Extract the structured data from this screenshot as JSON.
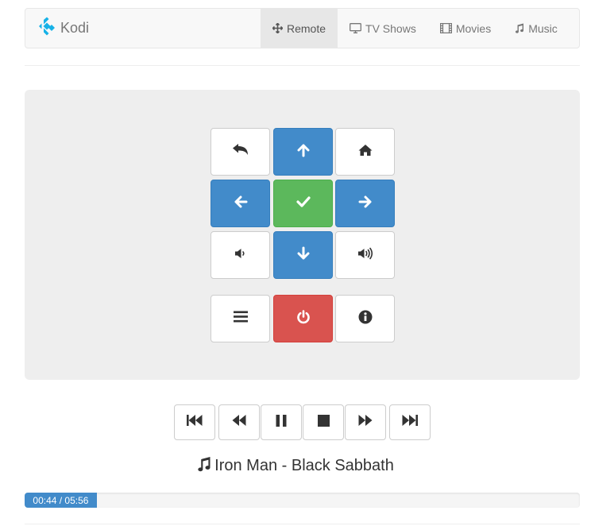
{
  "brand": {
    "name": "Kodi"
  },
  "nav": [
    {
      "label": "Remote",
      "icon": "move-icon",
      "active": true
    },
    {
      "label": "TV Shows",
      "icon": "tv-icon",
      "active": false
    },
    {
      "label": "Movies",
      "icon": "film-icon",
      "active": false
    },
    {
      "label": "Music",
      "icon": "music-note-icon",
      "active": false
    }
  ],
  "remote": {
    "buttons": [
      {
        "name": "back",
        "icon": "back-arrow-icon",
        "style": "default"
      },
      {
        "name": "up",
        "icon": "arrow-up-icon",
        "style": "primary"
      },
      {
        "name": "home",
        "icon": "home-icon",
        "style": "default"
      },
      {
        "name": "left",
        "icon": "arrow-left-icon",
        "style": "primary"
      },
      {
        "name": "select",
        "icon": "check-icon",
        "style": "success"
      },
      {
        "name": "right",
        "icon": "arrow-right-icon",
        "style": "primary"
      },
      {
        "name": "volume-down",
        "icon": "volume-down-icon",
        "style": "default"
      },
      {
        "name": "down",
        "icon": "arrow-down-icon",
        "style": "primary"
      },
      {
        "name": "volume-up",
        "icon": "volume-up-icon",
        "style": "default"
      },
      {
        "name": "menu",
        "icon": "menu-icon",
        "style": "default"
      },
      {
        "name": "power",
        "icon": "power-icon",
        "style": "danger"
      },
      {
        "name": "info",
        "icon": "info-icon",
        "style": "default"
      }
    ]
  },
  "transport": [
    {
      "name": "skip-previous",
      "icon": "skip-previous-icon"
    },
    {
      "name": "rewind",
      "icon": "rewind-icon"
    },
    {
      "name": "pause",
      "icon": "pause-icon"
    },
    {
      "name": "stop",
      "icon": "stop-icon"
    },
    {
      "name": "fast-forward",
      "icon": "fast-forward-icon"
    },
    {
      "name": "skip-next",
      "icon": "skip-next-icon"
    }
  ],
  "now_playing": {
    "text": "Iron Man - Black Sabbath",
    "icon": "music-note-icon"
  },
  "progress": {
    "label": "00:44 / 05:56",
    "elapsed_seconds": 44,
    "total_seconds": 356
  },
  "colors": {
    "primary": "#428bca",
    "success": "#5cb85c",
    "danger": "#d9534f",
    "panel": "#eeeeee",
    "brand_blue": "#17b2e7"
  }
}
